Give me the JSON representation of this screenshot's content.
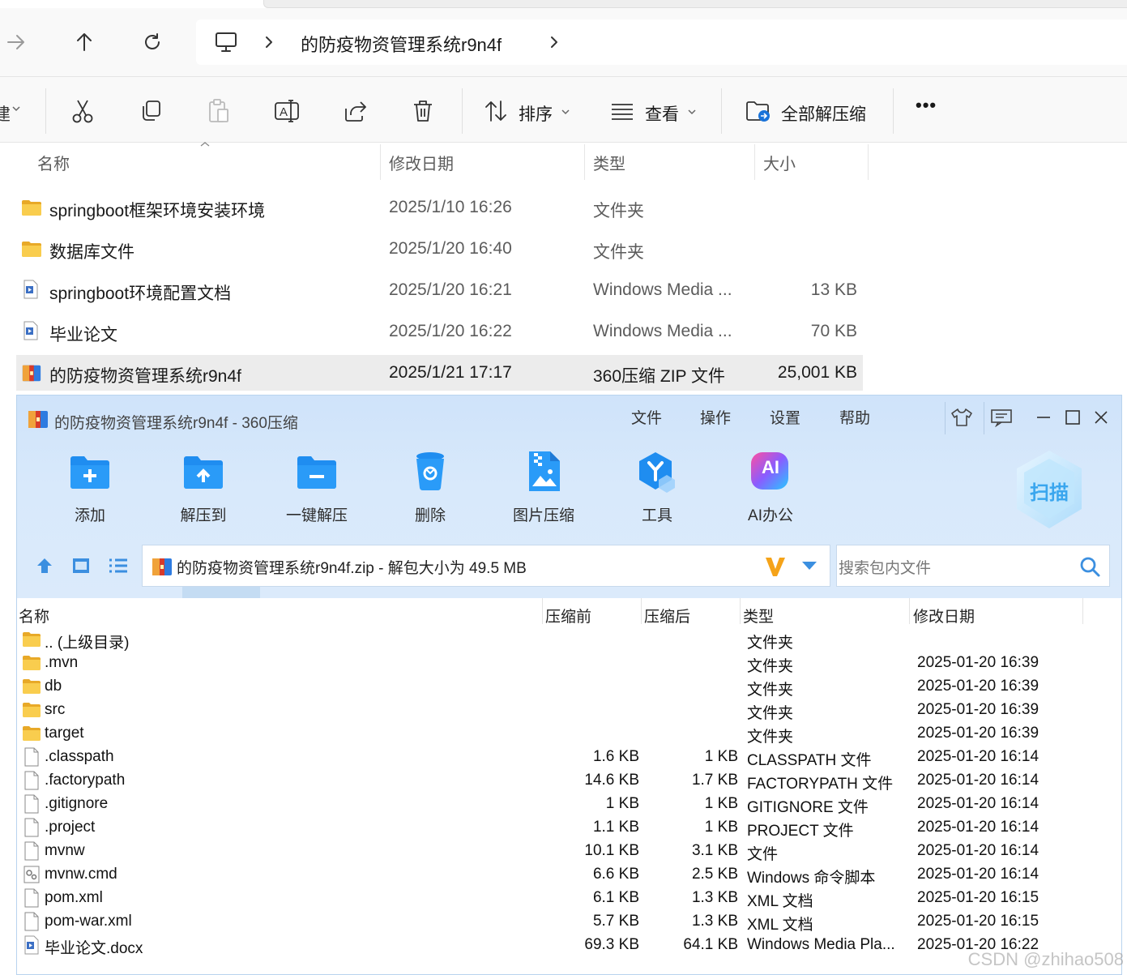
{
  "explorer": {
    "nav": {
      "back": "back",
      "forward": "forward",
      "up": "up",
      "refresh": "refresh"
    },
    "address": {
      "segment": "的防疫物资管理系统r9n4f"
    },
    "toolbar": {
      "new_partial": "建",
      "sort_label": "排序",
      "view_label": "查看",
      "extract_all_label": "全部解压缩",
      "more_label": "•••"
    },
    "columns": {
      "name": "名称",
      "date": "修改日期",
      "type": "类型",
      "size": "大小"
    },
    "files": [
      {
        "name": "springboot框架环境安装环境",
        "date": "2025/1/10 16:26",
        "type": "文件夹",
        "size": "",
        "icon": "folder-icon"
      },
      {
        "name": "数据库文件",
        "date": "2025/1/20 16:40",
        "type": "文件夹",
        "size": "",
        "icon": "folder-icon"
      },
      {
        "name": "springboot环境配置文档",
        "date": "2025/1/20 16:21",
        "type": "Windows Media ...",
        "size": "13 KB",
        "icon": "media-file-icon"
      },
      {
        "name": "毕业论文",
        "date": "2025/1/20 16:22",
        "type": "Windows Media ...",
        "size": "70 KB",
        "icon": "media-file-icon"
      },
      {
        "name": "的防疫物资管理系统r9n4f",
        "date": "2025/1/21 17:17",
        "type": "360压缩 ZIP 文件",
        "size": "25,001 KB",
        "icon": "zip-archive-icon",
        "selected": true
      }
    ]
  },
  "zip": {
    "title": "的防疫物资管理系统r9n4f - 360压缩",
    "menu": [
      "文件",
      "操作",
      "设置",
      "帮助"
    ],
    "toolbar": [
      {
        "label": "添加",
        "icon": "add-icon"
      },
      {
        "label": "解压到",
        "icon": "extract-to-icon"
      },
      {
        "label": "一键解压",
        "icon": "one-click-extract-icon"
      },
      {
        "label": "删除",
        "icon": "delete-icon"
      },
      {
        "label": "图片压缩",
        "icon": "image-compress-icon"
      },
      {
        "label": "工具",
        "icon": "tools-icon"
      },
      {
        "label": "AI办公",
        "icon": "ai-office-icon"
      }
    ],
    "scan_label": "扫描",
    "ai_badge": "AI",
    "path_text": "的防疫物资管理系统r9n4f.zip - 解包大小为 49.5 MB",
    "search_placeholder": "搜索包内文件",
    "columns": {
      "name": "名称",
      "before": "压缩前",
      "after": "压缩后",
      "type": "类型",
      "date": "修改日期"
    },
    "rows": [
      {
        "name": ".. (上级目录)",
        "before": "",
        "after": "",
        "type": "文件夹",
        "date": "",
        "icon": "folder-icon"
      },
      {
        "name": ".mvn",
        "before": "",
        "after": "",
        "type": "文件夹",
        "date": "2025-01-20 16:39",
        "icon": "folder-icon"
      },
      {
        "name": "db",
        "before": "",
        "after": "",
        "type": "文件夹",
        "date": "2025-01-20 16:39",
        "icon": "folder-icon"
      },
      {
        "name": "src",
        "before": "",
        "after": "",
        "type": "文件夹",
        "date": "2025-01-20 16:39",
        "icon": "folder-icon"
      },
      {
        "name": "target",
        "before": "",
        "after": "",
        "type": "文件夹",
        "date": "2025-01-20 16:39",
        "icon": "folder-icon"
      },
      {
        "name": ".classpath",
        "before": "1.6 KB",
        "after": "1 KB",
        "type": "CLASSPATH 文件",
        "date": "2025-01-20 16:14",
        "icon": "file-icon"
      },
      {
        "name": ".factorypath",
        "before": "14.6 KB",
        "after": "1.7 KB",
        "type": "FACTORYPATH 文件",
        "date": "2025-01-20 16:14",
        "icon": "file-icon"
      },
      {
        "name": ".gitignore",
        "before": "1 KB",
        "after": "1 KB",
        "type": "GITIGNORE 文件",
        "date": "2025-01-20 16:14",
        "icon": "file-icon"
      },
      {
        "name": ".project",
        "before": "1.1 KB",
        "after": "1 KB",
        "type": "PROJECT 文件",
        "date": "2025-01-20 16:14",
        "icon": "file-icon"
      },
      {
        "name": "mvnw",
        "before": "10.1 KB",
        "after": "3.1 KB",
        "type": "文件",
        "date": "2025-01-20 16:14",
        "icon": "file-icon"
      },
      {
        "name": "mvnw.cmd",
        "before": "6.6 KB",
        "after": "2.5 KB",
        "type": "Windows 命令脚本",
        "date": "2025-01-20 16:14",
        "icon": "script-file-icon"
      },
      {
        "name": "pom.xml",
        "before": "6.1 KB",
        "after": "1.3 KB",
        "type": "XML 文档",
        "date": "2025-01-20 16:15",
        "icon": "file-icon"
      },
      {
        "name": "pom-war.xml",
        "before": "5.7 KB",
        "after": "1.3 KB",
        "type": "XML 文档",
        "date": "2025-01-20 16:15",
        "icon": "file-icon"
      },
      {
        "name": "毕业论文.docx",
        "before": "69.3 KB",
        "after": "64.1 KB",
        "type": "Windows Media Pla...",
        "date": "2025-01-20 16:22",
        "icon": "media-file-icon"
      }
    ]
  },
  "watermark": "CSDN @zhihao508",
  "colors": {
    "accent": "#1a8ae8",
    "folder": "#f8c74a",
    "selected_row": "#ececec",
    "zip_header": "#d6e8fb"
  }
}
